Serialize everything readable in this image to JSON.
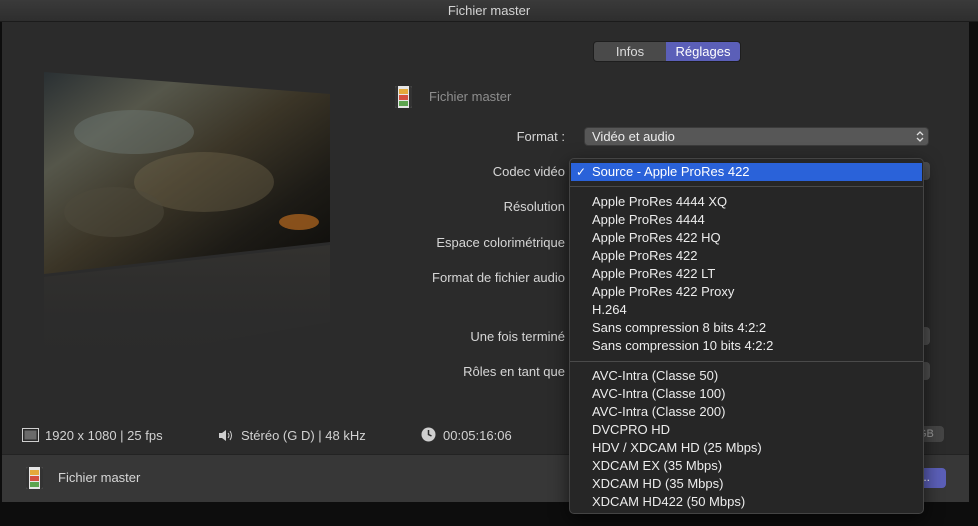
{
  "window": {
    "title": "Fichier master"
  },
  "tabs": [
    {
      "label": "Infos",
      "selected": false
    },
    {
      "label": "Réglages",
      "selected": true
    }
  ],
  "file": {
    "name": "Fichier master"
  },
  "settings": {
    "format_label": "Format :",
    "format_value": "Vidéo et audio",
    "codec_label": "Codec vidéo",
    "resolution_label": "Résolution",
    "colorspace_label": "Espace colorimétrique",
    "audio_format_label": "Format de fichier audio",
    "after_label": "Une fois terminé",
    "roles_label": "Rôles en tant que"
  },
  "status": {
    "resolution": "1920 x 1080 | 25 fps",
    "audio": "Stéréo (G D) | 48 kHz",
    "duration": "00:05:16:06",
    "size_partial": "GB"
  },
  "footer": {
    "label": "Fichier master",
    "next_button_partial": "..."
  },
  "codec_menu": {
    "selected": "Source - Apple ProRes 422",
    "group1": [
      "Apple ProRes 4444 XQ",
      "Apple ProRes 4444",
      "Apple ProRes 422 HQ",
      "Apple ProRes 422",
      "Apple ProRes 422 LT",
      "Apple ProRes 422 Proxy",
      "H.264",
      "Sans compression 8 bits 4:2:2",
      "Sans compression 10 bits 4:2:2"
    ],
    "group2": [
      "AVC-Intra (Classe 50)",
      "AVC-Intra (Classe 100)",
      "AVC-Intra (Classe 200)",
      "DVCPRO HD",
      "HDV / XDCAM HD (25 Mbps)",
      "XDCAM EX (35 Mbps)",
      "XDCAM HD (35 Mbps)",
      "XDCAM HD422 (50 Mbps)"
    ]
  },
  "colors": {
    "accent": "#5b5fb8",
    "menu_highlight": "#2a62d9"
  }
}
